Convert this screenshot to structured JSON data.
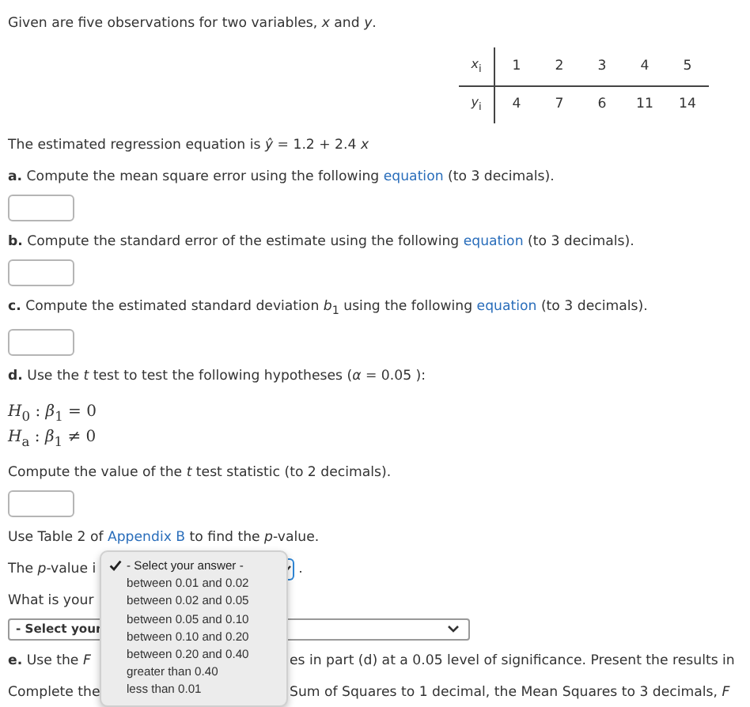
{
  "blocks": [
    {
      "kind": "text",
      "text": "Given are five observations for two variables, *x* and *y*."
    },
    {
      "kind": "table",
      "rows": [
        {
          "label": "*x*$_{i}$",
          "values": [
            "1",
            "2",
            "3",
            "4",
            "5"
          ]
        },
        {
          "label": "*y*$_{i}$",
          "values": [
            "4",
            "7",
            "6",
            "11",
            "14"
          ]
        }
      ]
    },
    {
      "kind": "text",
      "text": "The estimated regression equation is *ŷ* = 1.2 + 2.4 *x*"
    },
    {
      "kind": "link_text",
      "before": "**a.** Compute the mean square error using the following ",
      "link": "equation",
      "after": " (to 3 decimals)."
    },
    {
      "kind": "input"
    },
    {
      "kind": "link_text",
      "before": "**b.** Compute the standard error of the estimate using the following ",
      "link": "equation",
      "after": " (to 3 decimals)."
    },
    {
      "kind": "input"
    },
    {
      "kind": "link_text",
      "before": "**c.** Compute the estimated standard deviation *b*$_{1}$ using the following ",
      "link": "equation",
      "after": " (to 3 decimals)."
    },
    {
      "kind": "input"
    },
    {
      "kind": "text",
      "text": "**d.** Use the *t* test to test the following hypotheses (*α* = 0.05 ):"
    },
    {
      "kind": "hypotheses",
      "lines": [
        "*H*$_{0}$ : *β*$_{1}$ = 0",
        "*H*$_{a}$ : *β*$_{1}$ ≠ 0"
      ]
    },
    {
      "kind": "text",
      "text": "Compute the value of the *t* test statistic (to 2 decimals)."
    },
    {
      "kind": "input"
    },
    {
      "kind": "link_text",
      "before": "Use Table 2 of ",
      "link": "Appendix B",
      "after": " to find the *p*-value."
    },
    {
      "kind": "pvalue",
      "left": "The *p*-value i",
      "after": "."
    },
    {
      "kind": "split",
      "left": "What is your"
    },
    {
      "kind": "select",
      "value": "- Select your"
    },
    {
      "kind": "split",
      "left": "**e.** Use the *F*",
      "right": "es in part (d) at a 0.05 level of significance. Present the results in"
    },
    {
      "kind": "split",
      "left": "Complete the",
      "right": "Sum of Squares to 1 decimal, the Mean Squares to 3 decimals, *F*"
    }
  ],
  "dropdown": {
    "options": [
      {
        "label": "- Select your answer -",
        "selected": true
      },
      {
        "label": "between 0.01 and 0.02",
        "selected": false
      },
      {
        "label": "between 0.02 and 0.05",
        "selected": false
      },
      {
        "label": "between 0.05 and 0.10",
        "selected": false
      },
      {
        "label": "between 0.10 and 0.20",
        "selected": false
      },
      {
        "label": "between 0.20 and 0.40",
        "selected": false
      },
      {
        "label": "greater than 0.40",
        "selected": false
      },
      {
        "label": "less than 0.01",
        "selected": false
      }
    ]
  }
}
